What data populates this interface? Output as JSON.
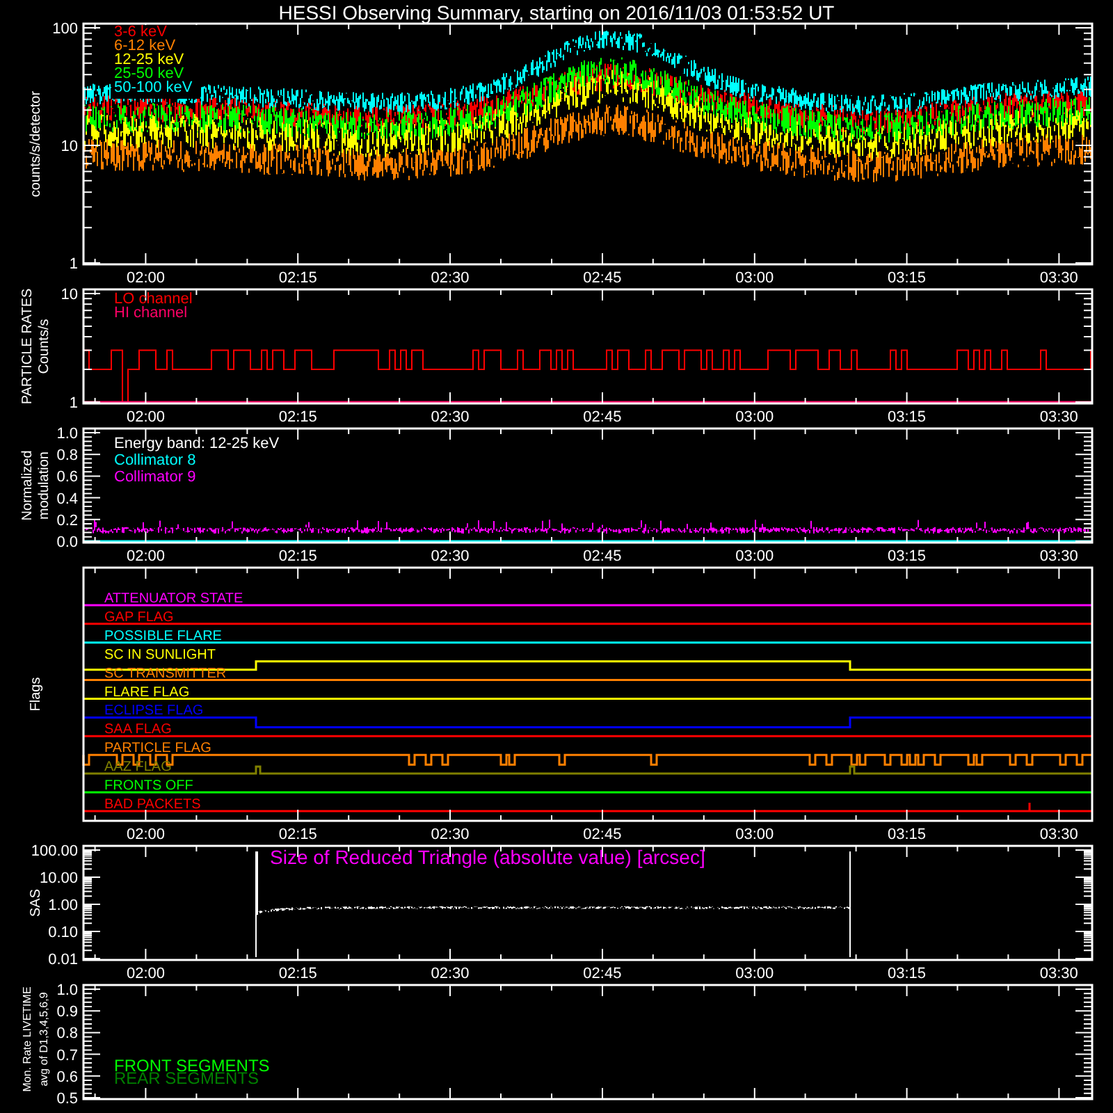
{
  "title": "HESSI Observing Summary, starting on 2016/11/03 01:53:52 UT",
  "panels": [
    {
      "kind": "counts",
      "ylabel": [
        "counts/s/detector"
      ],
      "yticks": [
        "100",
        "10",
        "1"
      ],
      "xticks": [
        "02:00",
        "02:15",
        "02:30",
        "02:45",
        "03:00",
        "03:15",
        "03:30"
      ],
      "legend": [
        {
          "label": "3-6 keV",
          "color": "#ff0000"
        },
        {
          "label": "6-12 keV",
          "color": "#ff8000"
        },
        {
          "label": "12-25 keV",
          "color": "#ffff00"
        },
        {
          "label": "25-50 keV",
          "color": "#00ff00"
        },
        {
          "label": "50-100 keV",
          "color": "#00ffff"
        }
      ]
    },
    {
      "kind": "particle",
      "ylabel": [
        "PARTICLE RATES",
        "Counts/s"
      ],
      "yticks": [
        "10",
        "1"
      ],
      "xticks": [
        "02:00",
        "02:15",
        "02:30",
        "02:45",
        "03:00",
        "03:15",
        "03:30"
      ],
      "legend": [
        {
          "label": "LO channel",
          "color": "#ff0000"
        },
        {
          "label": "HI channel",
          "color": "#ff0066"
        }
      ]
    },
    {
      "kind": "modulation",
      "ylabel": [
        "Normalized",
        "modulation"
      ],
      "yticks": [
        "1.0",
        "0.8",
        "0.6",
        "0.4",
        "0.2",
        "0.0"
      ],
      "xticks": [
        "02:00",
        "02:15",
        "02:30",
        "02:45",
        "03:00",
        "03:15",
        "03:30"
      ],
      "legend": [
        {
          "label": "Energy band: 12-25 keV",
          "color": "#ffffff"
        },
        {
          "label": "Collimator 8",
          "color": "#00ffff"
        },
        {
          "label": "Collimator 9",
          "color": "#ff00ff"
        }
      ]
    },
    {
      "kind": "flags",
      "ylabel": [
        "Flags"
      ],
      "xticks": [
        "02:00",
        "02:15",
        "02:30",
        "02:45",
        "03:00",
        "03:15",
        "03:30"
      ],
      "flags": [
        {
          "label": "ATTENUATOR STATE",
          "color": "#ff00ff",
          "kind": "flat"
        },
        {
          "label": "GAP FLAG",
          "color": "#ff0000",
          "kind": "flat"
        },
        {
          "label": "POSSIBLE FLARE",
          "color": "#00ffff",
          "kind": "flat"
        },
        {
          "label": "SC IN SUNLIGHT",
          "color": "#ffff00",
          "kind": "window_high"
        },
        {
          "label": "SC TRANSMITTER",
          "color": "#ff8000",
          "kind": "flat"
        },
        {
          "label": "FLARE FLAG",
          "color": "#ffff00",
          "kind": "flat"
        },
        {
          "label": "ECLIPSE FLAG",
          "color": "#0000ff",
          "kind": "window_low"
        },
        {
          "label": "SAA FLAG",
          "color": "#ff0000",
          "kind": "flat"
        },
        {
          "label": "PARTICLE FLAG",
          "color": "#ff8000",
          "kind": "pulses"
        },
        {
          "label": "AAZ FLAG",
          "color": "#808000",
          "kind": "spike"
        },
        {
          "label": "FRONTS OFF",
          "color": "#00ff00",
          "kind": "flat"
        },
        {
          "label": "BAD PACKETS",
          "color": "#ff0000",
          "kind": "blip"
        }
      ]
    },
    {
      "kind": "sas",
      "ylabel": [
        "SAS"
      ],
      "yticks": [
        "100.00",
        "10.00",
        "1.00",
        "0.10",
        "0.01"
      ],
      "xticks": [
        "02:00",
        "02:15",
        "02:30",
        "02:45",
        "03:00",
        "03:15",
        "03:30"
      ],
      "legend": [
        {
          "label": "Size of Reduced Triangle (absolute value) [arcsec]",
          "color": "#ff00ff"
        }
      ]
    },
    {
      "kind": "livetime",
      "ylabel": [
        "Mon. Rate LIVETIME",
        "avg of D1,3,4,5,6,9"
      ],
      "yticks": [
        "1.0",
        "0.9",
        "0.8",
        "0.7",
        "0.6",
        "0.5"
      ],
      "legend": [
        {
          "label": "FRONT SEGMENTS",
          "color": "#00ff00"
        },
        {
          "label": "REAR SEGMENTS",
          "color": "#008000"
        }
      ]
    }
  ]
}
